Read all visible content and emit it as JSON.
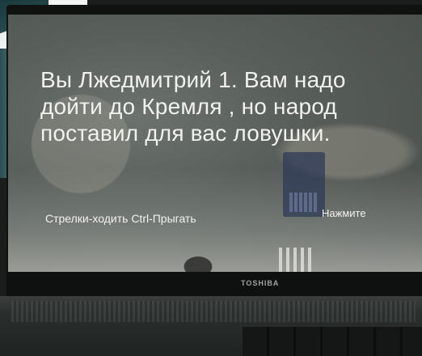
{
  "game": {
    "message": "Вы Лжедмитрий 1. Вам надо дойти до Кремля , но народ поставил для вас ловушки.",
    "controls_hint": "Стрелки-ходить Ctrl-Прыгать",
    "press_button": "Нажмите"
  },
  "laptop": {
    "brand": "TOSHIBA"
  }
}
